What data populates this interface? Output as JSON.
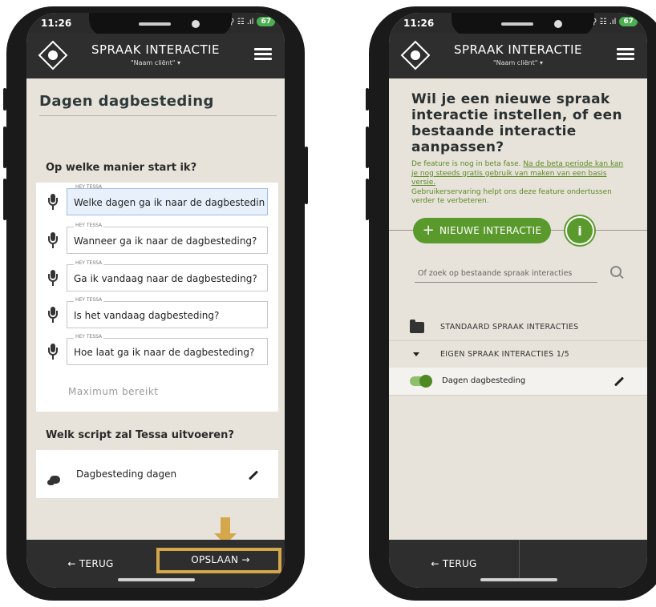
{
  "status": {
    "time": "11:26",
    "signal": "⚲ ☷ .ıl",
    "battery": "67"
  },
  "app": {
    "title": "SPRAAK INTERACTIE",
    "subtitle": "\"Naam cliënt\" ▾"
  },
  "left": {
    "page_title": "Dagen dagbesteding",
    "start_heading": "Op welke manier start ik?",
    "utterance_label": "HEY TESSA",
    "utterances": [
      "Welke dagen ga ik naar de dagbesteding?",
      "Wanneer ga ik naar de dagbesteding?",
      "Ga ik vandaag naar de dagbesteding?",
      "Is het vandaag dagbesteding?",
      "Hoe laat ga ik naar de dagbesteding?"
    ],
    "max_reached": "Maximum bereikt",
    "script_heading": "Welk script zal Tessa uitvoeren?",
    "script_name": "Dagbesteding dagen",
    "back_label": "← TERUG",
    "save_label": "OPSLAAN →"
  },
  "right": {
    "question": "Wil je een nieuwe spraak interactie instellen, of een bestaande interactie aanpassen?",
    "beta_text_1": "De feature is nog in beta fase. ",
    "beta_link": "Na de beta periode kan kan je nog steeds gratis gebruik van maken van een basis versie.",
    "beta_text_2": "Gebruikerservaring helpt ons deze feature ondertussen verder te verbeteren.",
    "new_button": "NIEUWE INTERACTIE",
    "info_label": "i",
    "search_placeholder": "Of zoek op bestaande spraak interacties",
    "standard_category": "STANDAARD SPRAAK INTERACTIES",
    "own_category": "EIGEN SPRAAK INTERACTIES 1/5",
    "item_name": "Dagen dagbesteding",
    "item_enabled": true,
    "back_label": "← TERUG"
  },
  "colors": {
    "accent_green": "#5a9a2c",
    "highlight": "#d4a84a",
    "bar": "#2e2e2e",
    "bg": "#e7e3da"
  }
}
